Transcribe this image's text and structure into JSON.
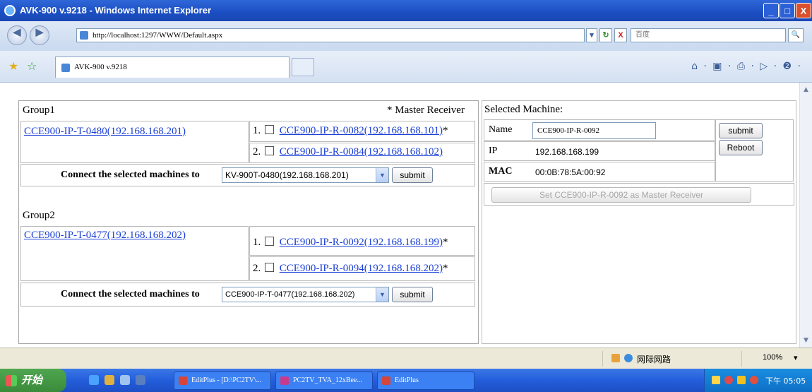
{
  "window": {
    "title": "AVK-900 v.9218 - Windows Internet Explorer",
    "minimize": "_",
    "maximize": "□",
    "close": "X"
  },
  "addressbar": {
    "back": "◀",
    "forward": "▶",
    "url": "http://localhost:1297/WWW/Default.aspx",
    "dropdown": "▾",
    "refresh": "↻",
    "stop": "X",
    "search_placeholder": "百度",
    "search_btn": "🔍"
  },
  "tabbar": {
    "fav_star": "★",
    "add_fav": "☆",
    "tab_title": "AVK-900 v.9218",
    "tools": "⌂ · ▣ · ⎙ · ▷ · ❷ ·"
  },
  "group1": {
    "title": "Group1",
    "master_note": "* Master Receiver",
    "transmitter": "CCE900-IP-T-0480(192.168.168.201)",
    "receivers": [
      {
        "num": "1.",
        "name": "CCE900-IP-R-0082(192.168.168.101)",
        "mark": "*"
      },
      {
        "num": "2.",
        "name": "CCE900-IP-R-0084(192.168.168.102)",
        "mark": ""
      }
    ],
    "connect_label": "Connect the selected machines to",
    "select_value": "KV-900T-0480(192.168.168.201)",
    "submit": "submit"
  },
  "group2": {
    "title": "Group2",
    "transmitter": "CCE900-IP-T-0477(192.168.168.202)",
    "receivers": [
      {
        "num": "1.",
        "name": "CCE900-IP-R-0092(192.168.168.199)",
        "mark": "*"
      },
      {
        "num": "2.",
        "name": "CCE900-IP-R-0094(192.168.168.202)",
        "mark": "*"
      }
    ],
    "connect_label": "Connect the selected machines to",
    "select_value": "CCE900-IP-T-0477(192.168.168.202)",
    "submit": "submit"
  },
  "selected": {
    "title": "Selected Machine:",
    "name_label": "Name",
    "name_value": "CCE900-IP-R-0092",
    "ip_label": "IP",
    "ip_value": "192.168.168.199",
    "mac_label": "MAC",
    "mac_value": "00:0B:78:5A:00:92",
    "submit": "submit",
    "reboot": "Reboot",
    "set_master": "Set CCE900-IP-R-0092 as Master Receiver"
  },
  "statusbar": {
    "zone": "网际网路",
    "zoom": "100%"
  },
  "taskbar": {
    "start": "开始",
    "tasks": [
      "EditPlus - [D:\\PC2TV\\...",
      "PC2TV_TVA_12xBee...",
      "EditPlus"
    ],
    "clock": "下午 05:05"
  },
  "colors": {
    "titlebar": "#1b4ec2",
    "link": "#1a3fd6",
    "taskbar": "#245edb",
    "start": "#3a8b3a"
  }
}
